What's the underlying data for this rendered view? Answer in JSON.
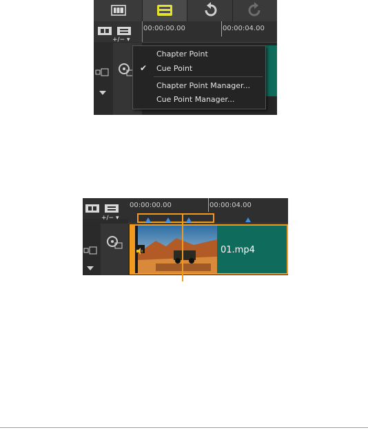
{
  "panel_top": {
    "ruler": {
      "time_start": "00:00:00.00",
      "time_mid": "00:00:04.00"
    },
    "add_remove_label": "+/−",
    "context_menu": {
      "items": [
        {
          "label": "Chapter Point",
          "checked": false
        },
        {
          "label": "Cue Point",
          "checked": true
        },
        {
          "label": "Chapter Point Manager...",
          "checked": false
        },
        {
          "label": "Cue Point Manager...",
          "checked": false
        }
      ]
    }
  },
  "panel_bottom": {
    "ruler": {
      "time_start": "00:00:00.00",
      "time_mid": "00:00:04.00"
    },
    "add_remove_label": "+/−",
    "clip": {
      "filename": "01.mp4"
    }
  },
  "colors": {
    "timeline_bg": "#2b2b2b",
    "clip_teal": "#0f6b5c",
    "highlight_orange": "#f29a1e",
    "marker_blue": "#3a8ee6",
    "active_yellow": "#e4e22a"
  }
}
